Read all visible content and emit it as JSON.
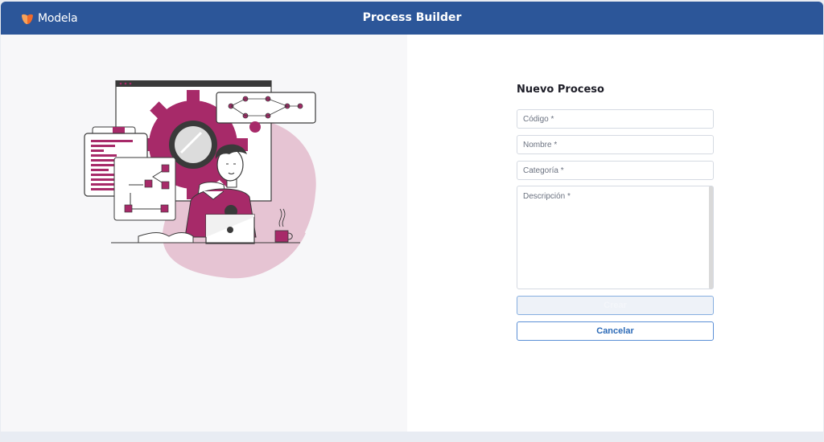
{
  "header": {
    "brand": "Modela",
    "title": "Process Builder",
    "brand_icon": "modela-logo-icon",
    "color": "#2c5699"
  },
  "illustration": {
    "icon": "process-builder-illustration",
    "accent_color": "#a72a69"
  },
  "form": {
    "title": "Nuevo Proceso",
    "codigo_placeholder": "Código *",
    "nombre_placeholder": "Nombre *",
    "categoria_placeholder": "Categoría *",
    "descripcion_placeholder": "Descripción *",
    "create_label": "Crear",
    "cancel_label": "Cancelar"
  }
}
